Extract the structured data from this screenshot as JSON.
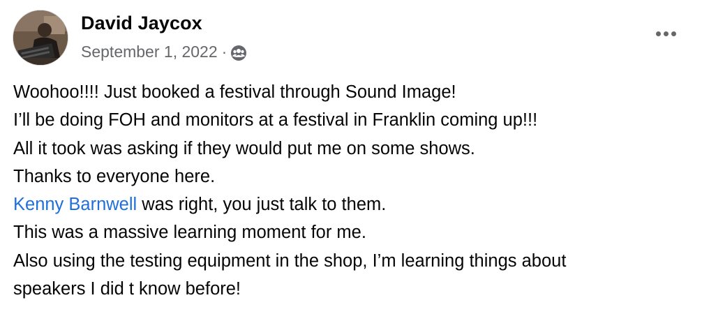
{
  "post": {
    "author": "David Jaycox",
    "date": "September 1, 2022",
    "separator": "·",
    "audience_icon": "group-audience-icon",
    "more_icon": "more-options-icon",
    "lines": [
      "Woohoo!!!! Just booked a festival through Sound Image!",
      "I’ll be doing FOH and monitors at a festival in Franklin coming up!!!",
      "All it took was asking if they would put me on some shows.",
      "Thanks to everyone here."
    ],
    "mention_line": {
      "mention": "Kenny Barnwell",
      "rest": " was right, you just talk to them."
    },
    "lines_after": [
      "This was a massive learning moment for me.",
      "Also using the testing equipment in the shop, I’m learning things about",
      "speakers I did t know before!"
    ]
  },
  "colors": {
    "text": "#050505",
    "secondary": "#65676b",
    "link": "#216fdb"
  }
}
